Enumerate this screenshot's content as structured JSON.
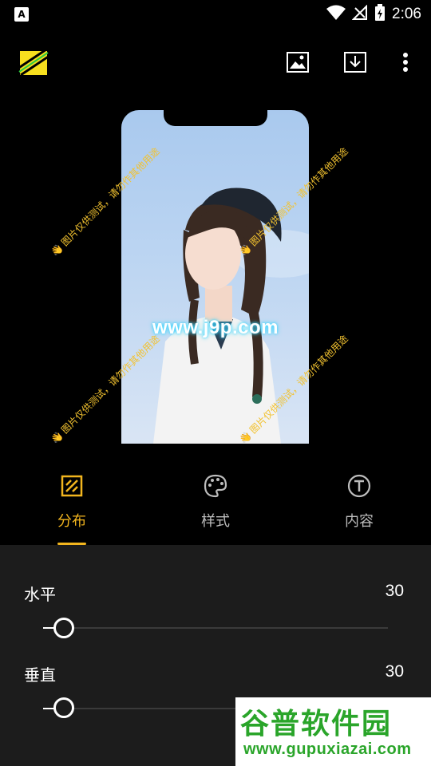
{
  "status_bar": {
    "app_badge": "A",
    "time": "2:06",
    "icons": [
      "wifi-icon",
      "no-signal-icon",
      "battery-charging-icon"
    ]
  },
  "app_bar": {
    "logo": "app-logo",
    "actions": [
      {
        "name": "image-icon"
      },
      {
        "name": "download-icon"
      },
      {
        "name": "more-vert-icon"
      }
    ]
  },
  "preview": {
    "site_watermark": "www.j9p.com",
    "tile_text": "图片仅供测试，请勿作其他用途",
    "tile_emoji": "👋"
  },
  "tabs": [
    {
      "label": "分布",
      "icon": "distribution-icon",
      "active": true
    },
    {
      "label": "样式",
      "icon": "palette-icon",
      "active": false
    },
    {
      "label": "内容",
      "icon": "text-t-icon",
      "active": false
    }
  ],
  "controls": {
    "horizontal": {
      "label": "水平",
      "value": "30",
      "level": 0.06
    },
    "vertical": {
      "label": "垂直",
      "value": "30",
      "level": 0.06
    }
  },
  "corner_watermark": {
    "title": "谷普软件园",
    "url": "www.gupuxiazai.com"
  },
  "colors": {
    "accent": "#f2b51e",
    "panel": "#1c1c1c",
    "background": "#000000"
  }
}
